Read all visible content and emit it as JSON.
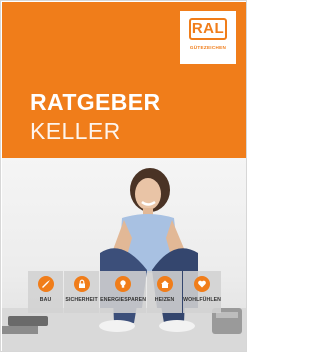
{
  "brand": {
    "logo_text": "RAL",
    "logo_subtext": "GÜTEZEICHEN",
    "accent_color": "#f07d1a"
  },
  "title": {
    "line1": "RATGEBER",
    "line2": "KELLER"
  },
  "icons": [
    {
      "label": "BAU",
      "icon": "trowel-icon"
    },
    {
      "label": "SICHERHEIT",
      "icon": "lock-icon"
    },
    {
      "label": "ENERGIESPAREN",
      "icon": "lightbulb-icon"
    },
    {
      "label": "HEIZEN",
      "icon": "house-icon"
    },
    {
      "label": "WOHLFÜHLEN",
      "icon": "heart-icon"
    }
  ]
}
